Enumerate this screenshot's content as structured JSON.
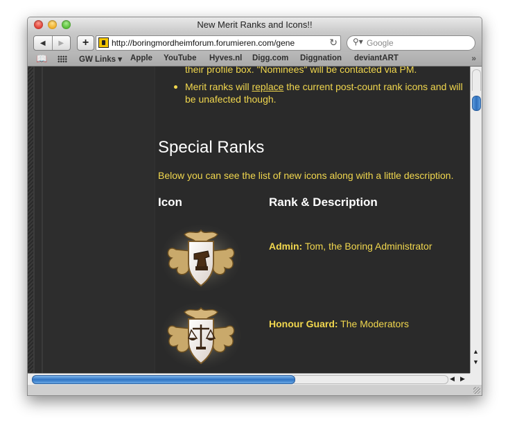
{
  "window": {
    "title": "New Merit Ranks and Icons!!"
  },
  "toolbar": {
    "back_label": "◀",
    "forward_label": "▶",
    "add_label": "+",
    "url": "http://boringmordheimforum.forumieren.com/gene",
    "reload_label": "↻",
    "search_placeholder": "Google",
    "search_icon": "magnifier-icon"
  },
  "bookmarks_bar": {
    "reading_list_icon": "book-icon",
    "top_sites_icon": "grid-icon",
    "items": [
      {
        "label": "GW Links ▾"
      },
      {
        "label": "Apple"
      },
      {
        "label": "YouTube"
      },
      {
        "label": "Hyves.nl"
      },
      {
        "label": "Digg.com"
      },
      {
        "label": "Diggnation"
      },
      {
        "label": "deviantART"
      }
    ],
    "more_label": "»"
  },
  "content": {
    "top_partial_line": "their profile box. \"Nominees\" will be contacted via PM.",
    "bullet": {
      "before": "Merit ranks will ",
      "link": "replace",
      "after": " the current post-count rank icons and will be unafected though."
    },
    "section_title": "Special Ranks",
    "intro": "Below you can see the list of new icons along with a little description.",
    "columns": {
      "icon": "Icon",
      "rank_description": "Rank & Description"
    },
    "ranks": [
      {
        "name": "Admin:",
        "description": " Tom, the Boring Administrator",
        "icon": "crest-anvil-icon"
      },
      {
        "name": "Honour Guard:",
        "description": " The Moderators",
        "icon": "crest-scales-icon"
      }
    ]
  },
  "colors": {
    "page_background": "#2a2a2a",
    "text_gold": "#f1d74e",
    "heading_white": "#ffffff",
    "scroll_accent": "#2f74c4"
  }
}
